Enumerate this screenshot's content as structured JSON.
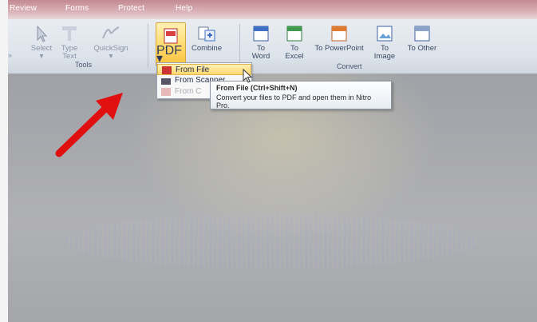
{
  "menu": {
    "tabs": [
      "Review",
      "Forms",
      "Protect",
      "Help"
    ]
  },
  "ribbon": {
    "tools": {
      "group_label": "Tools",
      "select_label": "Select",
      "type_text_label": "Type Text",
      "quicksign_label": "QuickSign"
    },
    "create": {
      "pdf_label": "PDF",
      "combine_label": "Combine"
    },
    "convert": {
      "group_label": "Convert",
      "to_word_label": "To Word",
      "to_excel_label": "To Excel",
      "to_powerpoint_label": "To PowerPoint",
      "to_image_label": "To Image",
      "to_other_label": "To Other"
    }
  },
  "pdf_dropdown": {
    "items": [
      "From File",
      "From Scanner",
      "From C"
    ]
  },
  "tooltip": {
    "title": "From File (Ctrl+Shift+N)",
    "body": "Convert your files to PDF and open them in Nitro Pro."
  },
  "colors": {
    "annotation_arrow": "#e01010",
    "highlight": "#ffd86e"
  }
}
